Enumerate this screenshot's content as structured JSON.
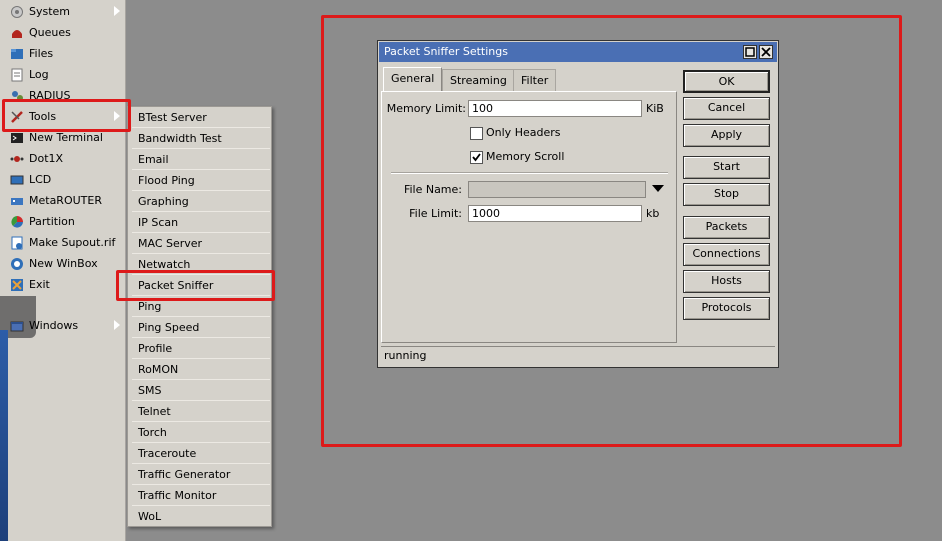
{
  "sidebar": {
    "items": [
      {
        "label": "System",
        "icon": "system-icon",
        "submenu": true
      },
      {
        "label": "Queues",
        "icon": "queues-icon"
      },
      {
        "label": "Files",
        "icon": "files-icon"
      },
      {
        "label": "Log",
        "icon": "log-icon"
      },
      {
        "label": "RADIUS",
        "icon": "radius-icon"
      },
      {
        "label": "Tools",
        "icon": "tools-icon",
        "submenu": true
      },
      {
        "label": "New Terminal",
        "icon": "terminal-icon"
      },
      {
        "label": "Dot1X",
        "icon": "dot1x-icon"
      },
      {
        "label": "LCD",
        "icon": "lcd-icon"
      },
      {
        "label": "MetaROUTER",
        "icon": "metarouter-icon"
      },
      {
        "label": "Partition",
        "icon": "partition-icon"
      },
      {
        "label": "Make Supout.rif",
        "icon": "supout-icon"
      },
      {
        "label": "New WinBox",
        "icon": "winbox-icon"
      },
      {
        "label": "Exit",
        "icon": "exit-icon"
      },
      {
        "label": "Windows",
        "icon": "windows-icon",
        "submenu": true
      }
    ]
  },
  "tools_menu": {
    "items": [
      "BTest Server",
      "Bandwidth Test",
      "Email",
      "Flood Ping",
      "Graphing",
      "IP Scan",
      "MAC Server",
      "Netwatch",
      "Packet Sniffer",
      "Ping",
      "Ping Speed",
      "Profile",
      "RoMON",
      "SMS",
      "Telnet",
      "Torch",
      "Traceroute",
      "Traffic Generator",
      "Traffic Monitor",
      "WoL"
    ]
  },
  "dialog": {
    "title": "Packet Sniffer Settings",
    "tabs": [
      "General",
      "Streaming",
      "Filter"
    ],
    "memory_limit_label": "Memory Limit:",
    "memory_limit_value": "100",
    "memory_limit_unit": "KiB",
    "only_headers_label": "Only Headers",
    "only_headers_checked": false,
    "memory_scroll_label": "Memory Scroll",
    "memory_scroll_checked": true,
    "file_name_label": "File Name:",
    "file_name_value": "",
    "file_limit_label": "File Limit:",
    "file_limit_value": "1000",
    "file_limit_unit": "kb",
    "buttons": [
      "OK",
      "Cancel",
      "Apply",
      "Start",
      "Stop",
      "Packets",
      "Connections",
      "Hosts",
      "Protocols"
    ],
    "status": "running"
  },
  "colors": {
    "highlight_border": "#dd1a1a",
    "titlebar": "#4a6fb4",
    "panel_bg": "#d5d2cb",
    "desktop_bg": "#8c8c8c"
  }
}
